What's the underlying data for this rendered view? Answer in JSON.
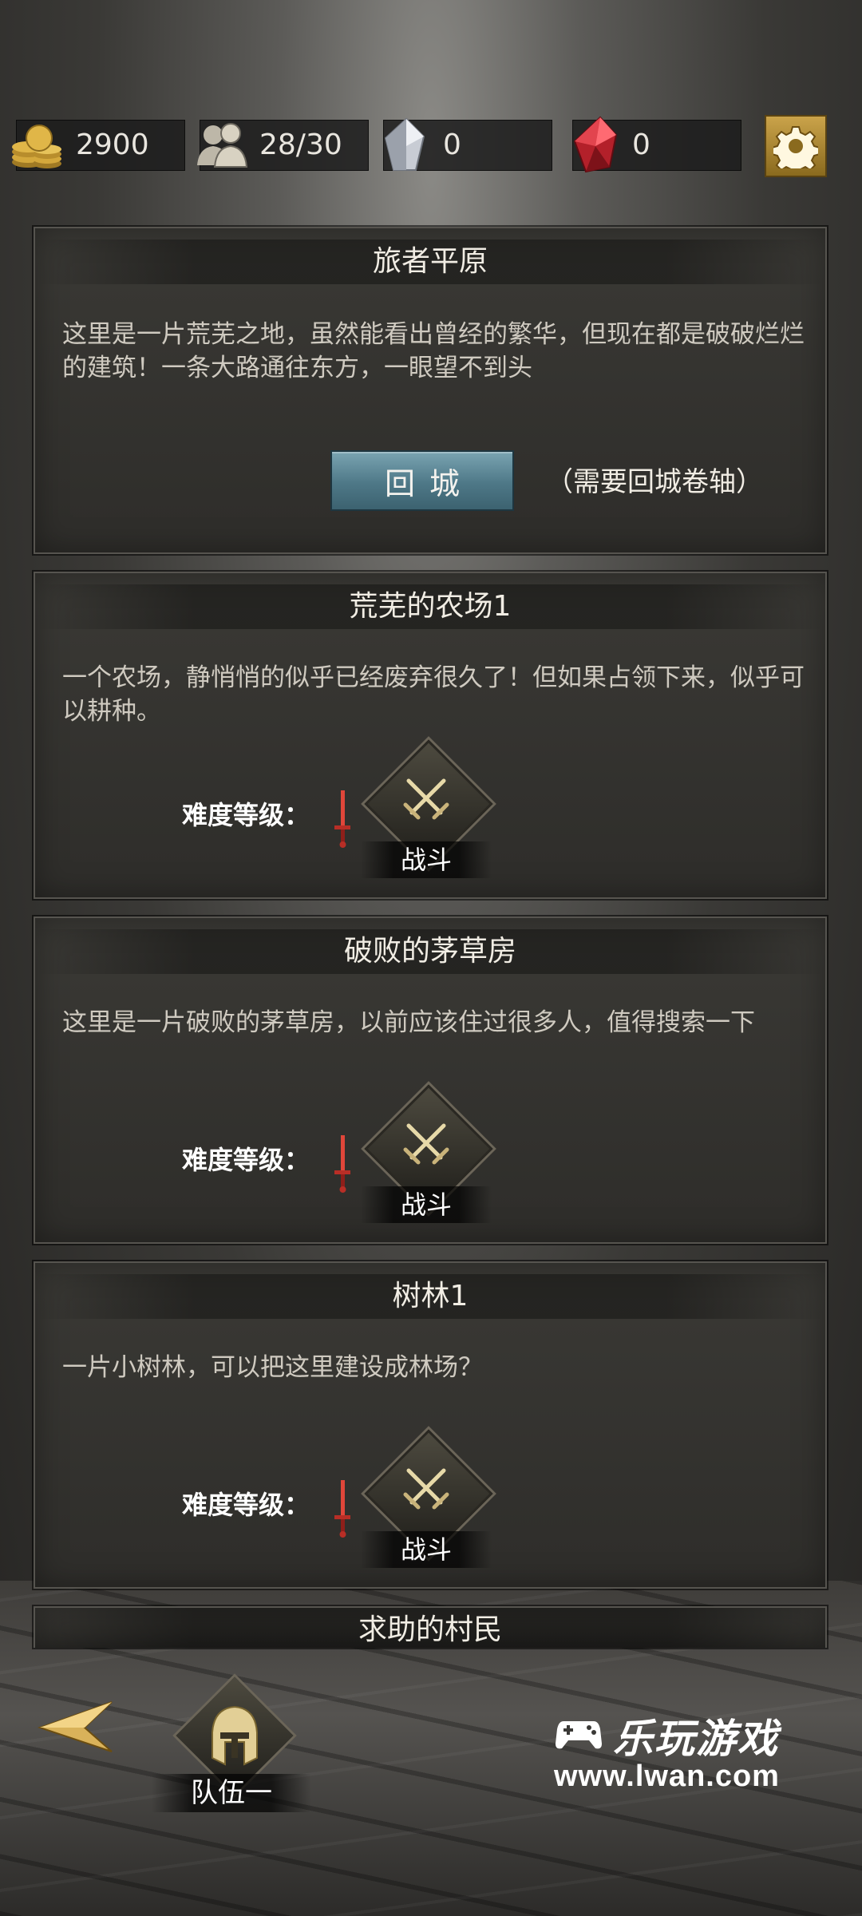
{
  "resources": {
    "gold": "2900",
    "population": "28/30",
    "crystal": "0",
    "ruby": "0"
  },
  "area": {
    "title": "旅者平原",
    "description": "这里是一片荒芜之地，虽然能看出曾经的繁华，但现在都是破破烂烂的建筑！一条大路通往东方，一眼望不到头",
    "return_button": "回城",
    "return_note": "（需要回城卷轴）"
  },
  "locations": [
    {
      "title": "荒芜的农场1",
      "description": "一个农场，静悄悄的似乎已经废弃很久了！但如果占领下来，似乎可以耕种。",
      "difficulty_label": "难度等级：",
      "action": "战斗"
    },
    {
      "title": "破败的茅草房",
      "description": "这里是一片破败的茅草房，以前应该住过很多人，值得搜索一下",
      "difficulty_label": "难度等级：",
      "action": "战斗"
    },
    {
      "title": "树林1",
      "description": "一片小树林，可以把这里建设成林场？",
      "difficulty_label": "难度等级：",
      "action": "战斗"
    },
    {
      "title": "求助的村民"
    }
  ],
  "bottom": {
    "team_label": "队伍一"
  },
  "watermark": {
    "name": "乐玩游戏",
    "url": "www.lwan.com"
  },
  "colors": {
    "panel_bg": "#2e2d2a",
    "return_button": "#4e7887",
    "settings_gold": "#caa34a",
    "difficulty_sword": "#d83a2e"
  },
  "icons": [
    "gold-coins-icon",
    "population-icon",
    "crystal-icon",
    "ruby-icon",
    "gear-icon",
    "crossed-swords-icon",
    "sword-icon",
    "back-arrow-icon",
    "helmet-icon",
    "gamepad-icon"
  ]
}
